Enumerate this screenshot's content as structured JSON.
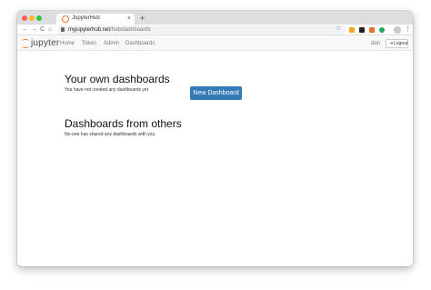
{
  "browser": {
    "tab_title": "JupyterHub",
    "tab_close": "×",
    "new_tab": "+",
    "url_host": "myjupyterhub.net",
    "url_path": "/hub/dashboards",
    "nav_back": "←",
    "nav_forward": "→",
    "nav_reload": "C",
    "nav_home": "⌂",
    "star_icon": "☆",
    "menu_icon": "⋮",
    "extension_colors": [
      "#f5a623",
      "#222222",
      "#e8712b",
      "#2ba55e"
    ]
  },
  "navbar": {
    "logo_text": "jupyter",
    "links": [
      "Home",
      "Token",
      "Admin",
      "Dashboards"
    ],
    "user": "dan",
    "logout_icon": "⇥",
    "logout_label": "Logout"
  },
  "main": {
    "own_heading": "Your own dashboards",
    "own_empty": "You have not created any dashboards yet",
    "new_button": "New Dashboard",
    "others_heading": "Dashboards from others",
    "others_empty": "No-one has shared any dashboards with you"
  },
  "colors": {
    "primary_button": "#337ab7",
    "jupyter_orange": "#f37726"
  }
}
